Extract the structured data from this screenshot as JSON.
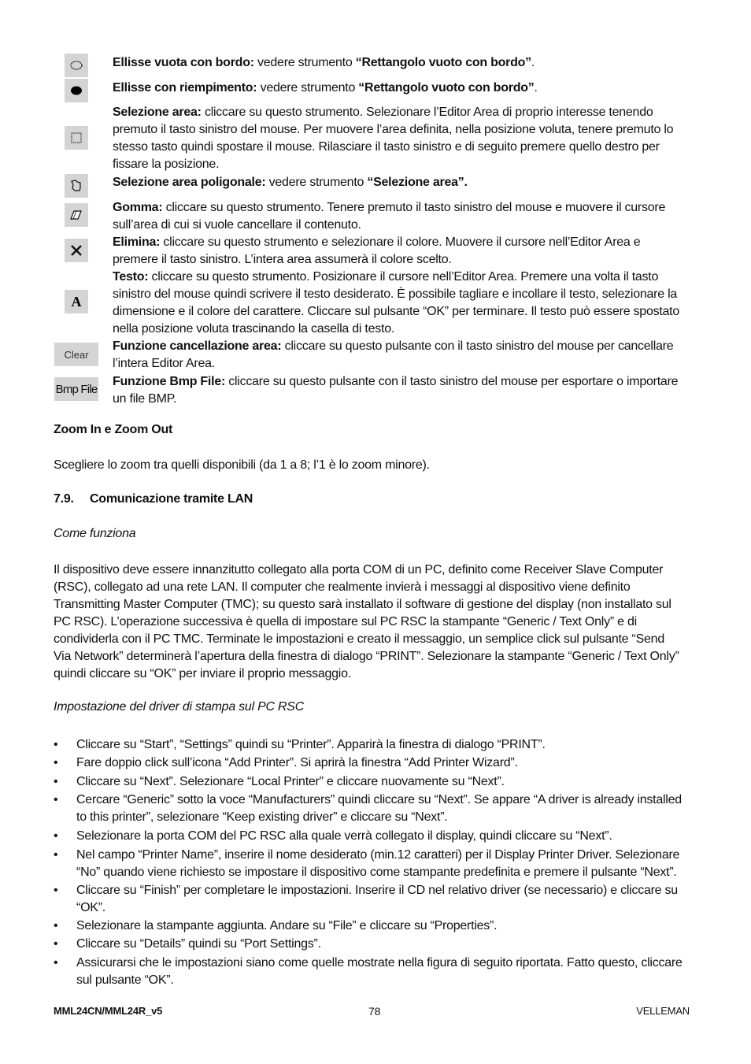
{
  "tools": [
    {
      "icon": "ellipse-outline-icon",
      "label": "Ellisse vuota con bordo:",
      "text": " vedere strumento ",
      "ref": "“Rettangolo vuoto con bordo”",
      "tail": "."
    },
    {
      "icon": "ellipse-filled-icon",
      "label": "Ellisse con riempimento:",
      "text": " vedere strumento ",
      "ref": "“Rettangolo vuoto con bordo”",
      "tail": "."
    },
    {
      "icon": "select-area-icon",
      "label": "Selezione area:",
      "lines": [
        " cliccare su questo strumento. Selezionare l’Editor Area di proprio interesse tenendo",
        "premuto il tasto sinistro del mouse. Per muovere l’area definita, nella posizione voluta, tenere premuto lo",
        "stesso tasto quindi spostare il mouse. Rilasciare il tasto sinistro e di seguito premere quello destro per",
        "fissare la posizione."
      ]
    },
    {
      "icon": "polygon-select-icon",
      "label": "Selezione area poligonale:",
      "text": " vedere strumento ",
      "ref": "“Selezione area”.",
      "tail": ""
    },
    {
      "icon": "eraser-icon",
      "label": "Gomma:",
      "lines": [
        " cliccare su questo strumento. Tenere premuto il tasto sinistro del mouse e muovere il cursore",
        "sull’area di cui si vuole cancellare il contenuto."
      ]
    },
    {
      "icon": "delete-x-icon",
      "label": "Elimina:",
      "lines": [
        " cliccare su questo strumento e selezionare il colore. Muovere il cursore nell’Editor Area e",
        "premere il tasto sinistro. L’intera area assumerà il colore scelto."
      ]
    },
    {
      "icon": "text-tool-icon",
      "label": "Testo:",
      "lines": [
        " cliccare su questo strumento. Posizionare il cursore nell’Editor Area. Premere una volta il tasto",
        "sinistro del mouse quindi scrivere il testo desiderato. È possibile tagliare e incollare il testo, selezionare la",
        "dimensione e il colore del carattere. Cliccare sul pulsante “OK” per terminare. Il testo può essere spostato",
        "nella posizione voluta trascinando la casella di testo."
      ]
    },
    {
      "icon": "clear-button",
      "button_label": "Clear",
      "label": "Funzione cancellazione area:",
      "lines": [
        " cliccare su questo pulsante con il tasto sinistro del mouse per cancellare",
        "l’intera Editor Area."
      ]
    },
    {
      "icon": "bmp-file-button",
      "button_label": "Bmp File",
      "label": "Funzione Bmp File:",
      "lines": [
        " cliccare su questo pulsante con il tasto sinistro del mouse per esportare o importare",
        "un file BMP."
      ]
    }
  ],
  "zoom_section": {
    "heading": "Zoom In e Zoom Out",
    "text": "Scegliere lo zoom tra quelli disponibili (da 1 a  8; l’1 è lo zoom minore)."
  },
  "lan_section": {
    "number": "7.9.",
    "title": "Comunicazione tramite LAN",
    "subheading1": "Come funziona",
    "paragraph_lines": [
      "Il dispositivo deve essere innanzitutto collegato alla porta COM di un PC, definito come Receiver Slave Computer",
      "(RSC), collegato ad una rete LAN. Il computer che realmente invierà i messaggi al dispositivo viene definito",
      "Transmitting Master Computer (TMC); su questo sarà installato il software di gestione del display (non installato sul",
      "PC RSC). L’operazione successiva è quella di impostare sul PC RSC la stampante “Generic / Text Only” e di",
      "condividerla con il PC TMC. Terminate le impostazioni e creato il messaggio, un semplice click sul pulsante “Send",
      "Via Network” determinerà l’apertura della finestra di dialogo “PRINT”. Selezionare la stampante “Generic / Text Only”",
      "quindi cliccare su “OK” per inviare il proprio messaggio."
    ],
    "subheading2": "Impostazione del driver di stampa sul PC RSC",
    "bullets": [
      [
        "Cliccare su “Start”, “Settings” quindi su “Printer”. Apparirà la finestra di dialogo “PRINT”."
      ],
      [
        "Fare doppio click sull’icona “Add Printer”. Si aprirà la finestra “Add Printer Wizard”."
      ],
      [
        "Cliccare su “Next”. Selezionare “Local Printer” e cliccare nuovamente su “Next”."
      ],
      [
        "Cercare “Generic” sotto la voce “Manufacturers” quindi cliccare su “Next”. Se appare “A driver is already installed",
        "to this printer”, selezionare “Keep existing driver” e cliccare su “Next”."
      ],
      [
        "Selezionare la porta COM del PC RSC alla quale verrà collegato il display, quindi cliccare su “Next”."
      ],
      [
        "Nel campo “Printer Name”, inserire il nome desiderato (min.12 caratteri) per il Display Printer Driver. Selezionare",
        "“No” quando viene richiesto se impostare il dispositivo come stampante predefinita e premere il pulsante “Next”."
      ],
      [
        "Cliccare su “Finish” per completare le impostazioni. Inserire il CD nel relativo driver (se necessario) e cliccare su",
        "“OK”."
      ],
      [
        "Selezionare la stampante aggiunta. Andare su “File” e cliccare su “Properties”."
      ],
      [
        "Cliccare su “Details” quindi su “Port Settings”."
      ],
      [
        "Assicurarsi che le impostazioni siano come quelle mostrate nella figura di seguito riportata. Fatto questo, cliccare",
        "sul pulsante “OK”."
      ]
    ]
  },
  "footer": {
    "left": "MML24CN/MML24R_v5",
    "page": "78",
    "right": "VELLEMAN"
  }
}
